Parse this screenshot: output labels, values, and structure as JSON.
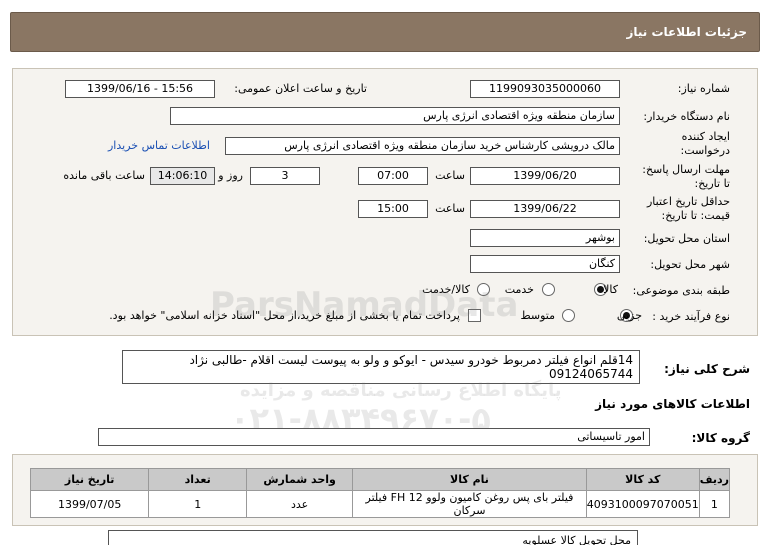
{
  "header": {
    "title": "جزئیات اطلاعات نیاز"
  },
  "form": {
    "need_number_label": "شماره نیاز:",
    "need_number": "1199093035000060",
    "announce_label": "تاریخ و ساعت اعلان عمومی:",
    "announce_value": "1399/06/16 - 15:56",
    "buyer_org_label": "نام دستگاه خریدار:",
    "buyer_org": "سازمان منطقه ویژه اقتصادی انرژی پارس",
    "creator_label_1": "ایجاد کننده",
    "creator_label_2": "درخواست:",
    "creator": "مالک  درویشی کارشناس خرید سازمان منطقه ویژه اقتصادی انرژی پارس",
    "contact_link": "اطلاعات تماس خریدار",
    "deadline_label_1": "مهلت ارسال پاسخ:",
    "deadline_label_2": "تا تاریخ:",
    "deadline_date": "1399/06/20",
    "time_label": "ساعت",
    "deadline_time": "07:00",
    "days_value": "3",
    "days_label": "روز و",
    "remaining_time": "14:06:10",
    "remaining_label": "ساعت باقی مانده",
    "validity_label_1": "حداقل تاریخ اعتبار",
    "validity_label_2": "قیمت: تا تاریخ:",
    "validity_date": "1399/06/22",
    "validity_time_label": "ساعت",
    "validity_time": "15:00",
    "province_label": "استان محل تحویل:",
    "province": "بوشهر",
    "city_label": "شهر محل تحویل:",
    "city": "کنگان",
    "category_label": "طبقه بندی موضوعی:",
    "category_options": [
      "کالا",
      "خدمت",
      "کالا/خدمت"
    ],
    "purchase_type_label": "نوع فرآیند خرید :",
    "purchase_options": [
      "جزیی",
      "متوسط"
    ],
    "payment_note": "پرداخت تمام یا بخشی از مبلغ خرید،از محل \"اسناد خزانه اسلامی\" خواهد بود."
  },
  "description": {
    "label": "شرح کلی نیاز:",
    "text": "14قلم انواع فیلتر دمربوط خودرو سیدس - ایوکو و ولو  به پیوست لیست اقلام -طالبی نژاد 09124065744"
  },
  "goods": {
    "section_title": "اطلاعات کالاهای مورد نیاز",
    "group_label": "گروه کالا:",
    "group_value": "امور تاسیساتی",
    "columns": [
      "ردیف",
      "کد کالا",
      "نام کالا",
      "واحد شمارش",
      "تعداد",
      "تاریخ نیاز"
    ],
    "rows": [
      [
        "1",
        "4093100097070051",
        "فیلتر بای پس روغن کامیون ولوو FH 12 فیلتر سرکان",
        "عدد",
        "1",
        "1399/07/05"
      ]
    ],
    "delivery_note": "محل تحویل کالا عسلویه"
  },
  "watermark": {
    "line1": "ParsNamadData",
    "line2": "پایگاه اطلاع رسانی مناقصه و مزایده",
    "line3": "۰۲۱-۸۸۳۴۹۶۷۰-۵"
  }
}
